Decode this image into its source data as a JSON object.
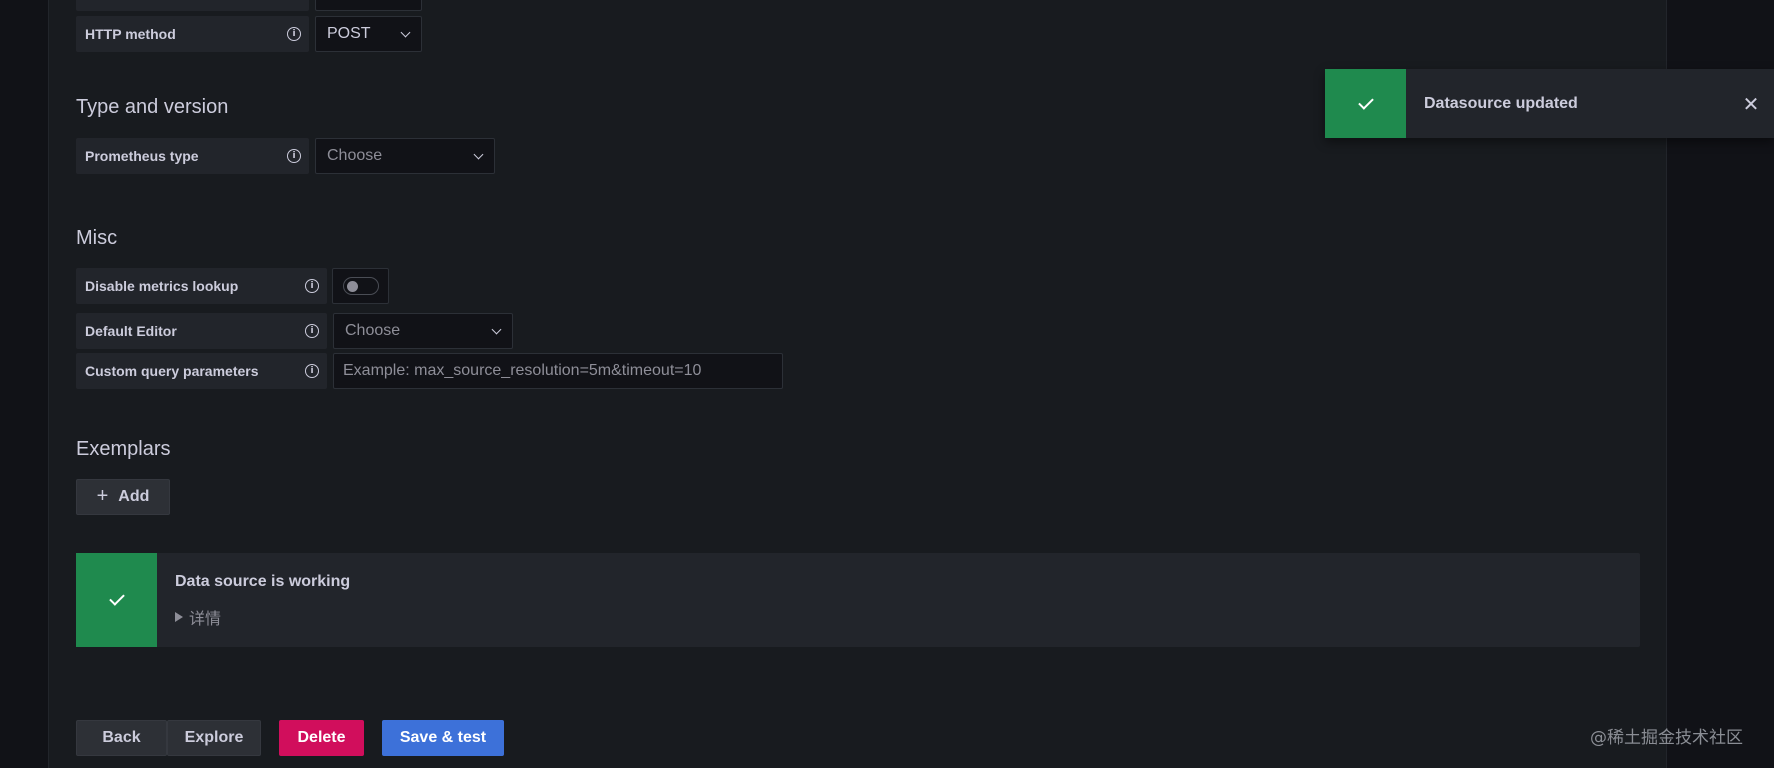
{
  "http_section": {
    "http_method_label": "HTTP method",
    "http_method_value": "POST"
  },
  "type_section": {
    "title": "Type and version",
    "prometheus_type_label": "Prometheus type",
    "prometheus_type_placeholder": "Choose"
  },
  "misc_section": {
    "title": "Misc",
    "disable_metrics_label": "Disable metrics lookup",
    "disable_metrics_enabled": false,
    "default_editor_label": "Default Editor",
    "default_editor_placeholder": "Choose",
    "custom_query_label": "Custom query parameters",
    "custom_query_placeholder": "Example: max_source_resolution=5m&timeout=10"
  },
  "exemplars_section": {
    "title": "Exemplars",
    "add_label": "Add"
  },
  "alert": {
    "title": "Data source is working",
    "details_label": "详情",
    "color": "#1f8a4e"
  },
  "footer_buttons": {
    "back": "Back",
    "explore": "Explore",
    "delete": "Delete",
    "save_test": "Save & test"
  },
  "toast": {
    "message": "Datasource updated",
    "close_glyph": "✕"
  },
  "watermark": "@稀土掘金技术社区",
  "colors": {
    "success": "#1f8a4e",
    "danger": "#d10e5c",
    "primary": "#3d71d9",
    "background": "#181b1f"
  }
}
